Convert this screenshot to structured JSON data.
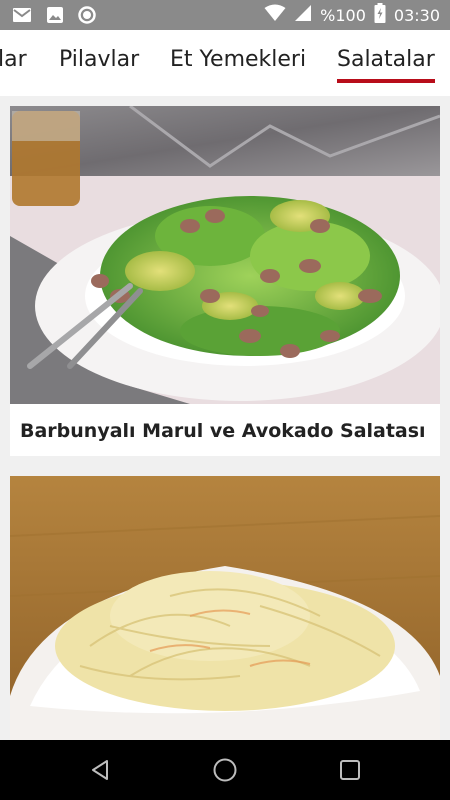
{
  "status_bar": {
    "battery_percent": "%100",
    "time": "03:30",
    "icons": [
      "mail-icon",
      "image-icon",
      "circle-icon",
      "wifi-icon",
      "signal-icon",
      "battery-icon"
    ]
  },
  "tabs": [
    {
      "label": "lar"
    },
    {
      "label": "Pilavlar"
    },
    {
      "label": "Et Yemekleri"
    },
    {
      "label": "Salatalar",
      "active": true
    }
  ],
  "recipes": [
    {
      "title": "Barbunyalı Marul ve Avokado Salatası"
    },
    {
      "title": ""
    }
  ],
  "nav": {
    "icons": [
      "back-icon",
      "home-icon",
      "recents-icon"
    ]
  },
  "colors": {
    "status_bar": "#8a8a8a",
    "accent": "#b80d1a",
    "background": "#f0f0f0",
    "nav_bar": "#000000"
  }
}
